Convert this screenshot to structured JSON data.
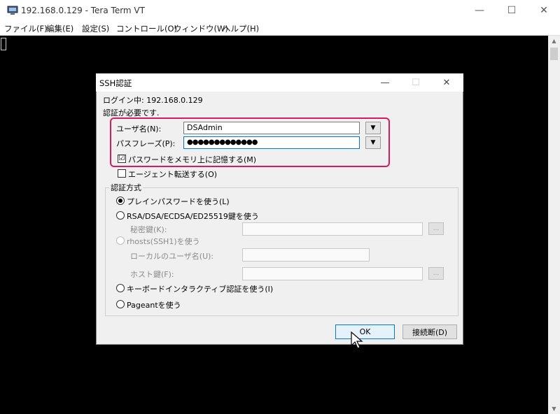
{
  "window": {
    "title": "192.168.0.129 - Tera Term VT",
    "minimize": "—",
    "maximize": "☐",
    "close": "✕"
  },
  "menu": [
    "ファイル(F)",
    "編集(E)",
    "設定(S)",
    "コントロール(O)",
    "ウィンドウ(W)",
    "ヘルプ(H)"
  ],
  "dialog": {
    "title": "SSH認証",
    "login_line": "ログイン中: 192.168.0.129",
    "auth_required": "認証が必要です.",
    "username_label": "ユーザ名(N):",
    "username_value": "DSAdmin",
    "passphrase_label": "パスフレーズ(P):",
    "passphrase_value": "●●●●●●●●●●●●●",
    "remember_label": "パスワードをメモリ上に記憶する(M)",
    "remember_checked": "☑",
    "agent_label": "エージェント転送する(O)",
    "method_group": "認証方式",
    "plain_label": "プレインパスワードを使う(L)",
    "rsa_label": "RSA/DSA/ECDSA/ED25519鍵を使う",
    "private_key_label": "秘密鍵(K):",
    "rhosts_label": "rhosts(SSH1)を使う",
    "local_user_label": "ローカルのユーザ名(U):",
    "host_key_label": "ホスト鍵(F):",
    "browse": "...",
    "keyboard_label": "キーボードインタラクティブ認証を使う(I)",
    "pageant_label": "Pageantを使う",
    "ok": "OK",
    "disconnect": "接続断(D)"
  },
  "colors": {
    "highlight": "#d81b60",
    "terminal_bg": "#000000",
    "accent": "#0078d7"
  }
}
